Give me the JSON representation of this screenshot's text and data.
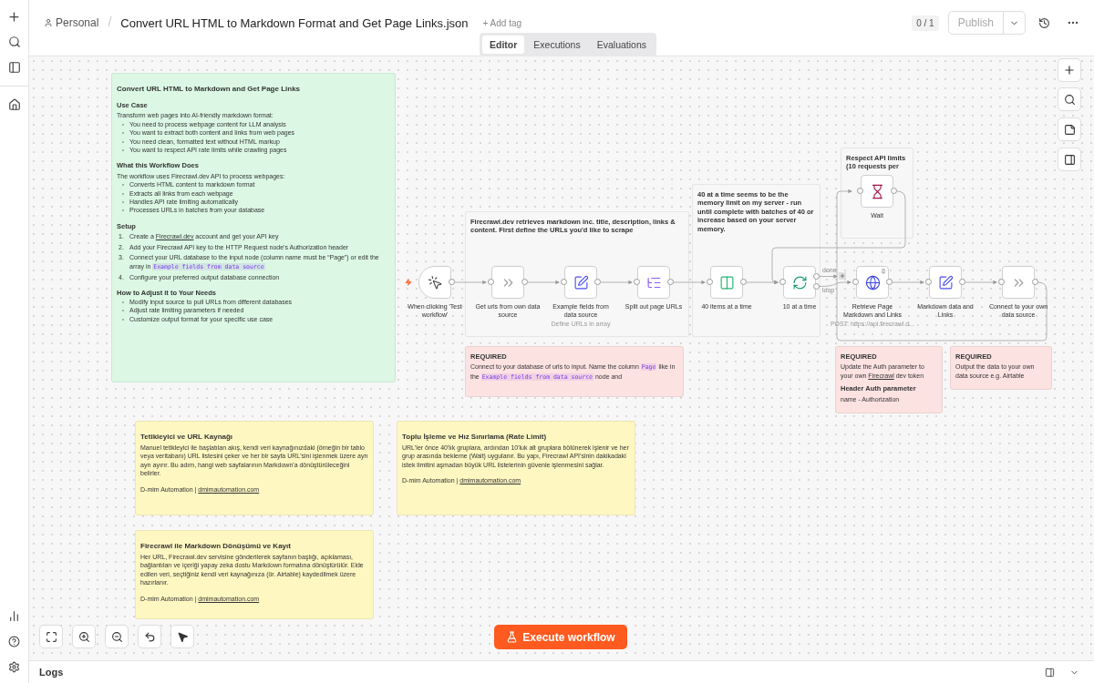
{
  "header": {
    "owner": "Personal",
    "separator": "/",
    "title": "Convert URL HTML to Markdown Format and Get Page Links.json",
    "add_tag": "+ Add tag",
    "counter": "0 / 1",
    "publish": "Publish"
  },
  "tabs": [
    {
      "label": "Editor",
      "selected": true
    },
    {
      "label": "Executions",
      "selected": false
    },
    {
      "label": "Evaluations",
      "selected": false
    }
  ],
  "stickies": [
    {
      "color": "#dcf8e4",
      "blocks": [
        {
          "kind": "title",
          "text": "Convert URL HTML to Markdown and Get Page Links"
        },
        {
          "kind": "heading",
          "text": "Use Case"
        },
        {
          "kind": "text",
          "text": "Transform web pages into AI-friendly markdown format:"
        },
        {
          "kind": "bullet",
          "text": "You need to process webpage content for LLM analysis"
        },
        {
          "kind": "bullet",
          "text": "You want to extract both content and links from web pages"
        },
        {
          "kind": "bullet",
          "text": "You need clean, formatted text without HTML markup"
        },
        {
          "kind": "bullet",
          "text": "You want to respect API rate limits while crawling pages"
        },
        {
          "kind": "heading",
          "text": "What this Workflow Does"
        },
        {
          "kind": "text",
          "text": "The workflow uses Firecrawl.dev API to process webpages:"
        },
        {
          "kind": "bullet",
          "text": "Converts HTML content to markdown format"
        },
        {
          "kind": "bullet",
          "text": "Extracts all links from each webpage"
        },
        {
          "kind": "bullet",
          "text": "Handles API rate limiting automatically"
        },
        {
          "kind": "bullet",
          "text": "Processes URLs in batches from your database"
        },
        {
          "kind": "heading",
          "text": "Setup"
        },
        {
          "kind": "numbered",
          "number": "1.",
          "segments": [
            {
              "kind": "text",
              "text": "Create a "
            },
            {
              "kind": "link",
              "text": "Firecrawl.dev"
            },
            {
              "kind": "text",
              "text": " account and get your API key"
            }
          ]
        },
        {
          "kind": "numbered",
          "number": "2.",
          "text": "Add your Firecrawl API key to the HTTP Request node's Authorization header"
        },
        {
          "kind": "numbered",
          "number": "3.",
          "segments": [
            {
              "kind": "text",
              "text": "Connect your URL database to the input node (column name must be “Page”) or edit the array in "
            },
            {
              "kind": "code",
              "text": "Example fields from data source"
            }
          ]
        },
        {
          "kind": "numbered",
          "number": "4.",
          "text": "Configure your preferred output database connection"
        },
        {
          "kind": "heading",
          "text": "How to Adjust it to Your Needs"
        },
        {
          "kind": "bullet",
          "text": "Modify input source to pull URLs from different databases"
        },
        {
          "kind": "bullet",
          "text": "Adjust rate limiting parameters if needed"
        },
        {
          "kind": "bullet",
          "text": "Customize output format for your specific use case"
        }
      ]
    },
    {
      "color": "#f7f7f8",
      "blocks": [
        {
          "kind": "label",
          "text": "Firecrawl.dev retrieves markdown inc. title, description, links & content. First define the URLs you'd like to scrape"
        }
      ]
    },
    {
      "color": "#f7f7f8",
      "blocks": [
        {
          "kind": "label",
          "text": "40 at a time seems to be the memory limit on my server - run until complete with batches of 40 or increase based on your server memory."
        }
      ]
    },
    {
      "color": "#f7f7f8",
      "blocks": [
        {
          "kind": "label",
          "text": "Respect API limits (10 requests per"
        }
      ]
    },
    {
      "color": "#fde2e2",
      "blocks": [
        {
          "kind": "label",
          "text": "REQUIRED"
        },
        {
          "kind": "text",
          "segments": [
            {
              "kind": "text",
              "text": "Connect to your database of urls to input. Name the column "
            },
            {
              "kind": "code",
              "text": "Page"
            },
            {
              "kind": "text",
              "text": " like in the "
            },
            {
              "kind": "code",
              "text": "Example fields from data source"
            },
            {
              "kind": "text",
              "text": " node and"
            }
          ]
        }
      ]
    },
    {
      "color": "#fde2e2",
      "blocks": [
        {
          "kind": "label",
          "text": "REQUIRED"
        },
        {
          "kind": "text",
          "segments": [
            {
              "kind": "text",
              "text": "Update the Auth parameter to your own "
            },
            {
              "kind": "link",
              "text": "Firecrawl"
            },
            {
              "kind": "text",
              "text": " dev token"
            }
          ]
        },
        {
          "kind": "heading",
          "text": "Header Auth parameter"
        },
        {
          "kind": "text",
          "text": "name - Authorization"
        }
      ]
    },
    {
      "color": "#fde2e2",
      "blocks": [
        {
          "kind": "label",
          "text": "REQUIRED"
        },
        {
          "kind": "text",
          "text": "Output the data to your own data source e.g. Airtable"
        }
      ]
    },
    {
      "color": "#fff7c2",
      "blocks": [
        {
          "kind": "title",
          "text": "Tetikleyici ve URL Kaynağı"
        },
        {
          "kind": "text",
          "text": "Manuel tetikleyici ile başlatılan akış, kendi veri kaynağınızdaki (örneğin bir tablo veya veritabanı) URL listesini çeker ve her bir sayfa URL'sini işlenmek üzere ayrı ayrı ayırır. Bu adım, hangi web sayfalarının Markdown'a dönüştürüleceğini belirler."
        },
        {
          "kind": "footer",
          "segments": [
            {
              "kind": "text",
              "text": "D-mim Automation | "
            },
            {
              "kind": "link",
              "text": "dmimautomation.com"
            }
          ]
        }
      ]
    },
    {
      "color": "#fff7c2",
      "blocks": [
        {
          "kind": "title",
          "text": "Toplu İşleme ve Hız Sınırlama (Rate Limit)"
        },
        {
          "kind": "text",
          "text": "URL'ler önce 40'lık gruplara, ardından 10'luk alt gruplara bölünerek işlenir ve her grup arasında bekleme (Wait) uygulanır. Bu yapı, Firecrawl API'sinin dakikadaki istek limitini aşmadan büyük URL listelerinin güvenle işlenmesini sağlar."
        },
        {
          "kind": "footer",
          "segments": [
            {
              "kind": "text",
              "text": "D-mim Automation | "
            },
            {
              "kind": "link",
              "text": "dmimautomation.com"
            }
          ]
        }
      ]
    },
    {
      "color": "#fff7c2",
      "blocks": [
        {
          "kind": "title",
          "text": "Firecrawl ile Markdown Dönüşümü ve Kayıt"
        },
        {
          "kind": "text",
          "text": "Her URL, Firecrawl.dev servisine gönderilerek sayfanın başlığı, açıklaması, bağlantıları ve içeriği yapay zeka dostu Markdown formatına dönüştürülür. Elde edilen veri, seçtiğiniz kendi veri kaynağınıza (ör. Airtable) kaydedilmek üzere hazırlanır."
        },
        {
          "kind": "footer",
          "segments": [
            {
              "kind": "text",
              "text": "D-mim Automation | "
            },
            {
              "kind": "link",
              "text": "dmimautomation.com"
            }
          ]
        }
      ]
    }
  ],
  "nodes": [
    {
      "kind": "trigger",
      "label": "When clicking 'Test workflow'"
    },
    {
      "kind": "noop",
      "label": "Get urls from own data source"
    },
    {
      "kind": "set",
      "label": "Example fields from data source",
      "subtitle": "Define URLs in array"
    },
    {
      "kind": "split",
      "label": "Split out page URLs"
    },
    {
      "kind": "limit",
      "label": "40 items at a time"
    },
    {
      "kind": "loop",
      "label": "10 at a time",
      "outputs": [
        "done",
        "loop"
      ]
    },
    {
      "kind": "wait",
      "label": "Wait"
    },
    {
      "kind": "http",
      "label": "Retrieve Page Markdown and Links",
      "subtitle": "POST: https://api.firecrawl.d..."
    },
    {
      "kind": "set",
      "label": "Markdown data and Links"
    },
    {
      "kind": "noop",
      "label": "Connect to your own data source"
    }
  ],
  "execute": "Execute workflow",
  "logs": "Logs"
}
